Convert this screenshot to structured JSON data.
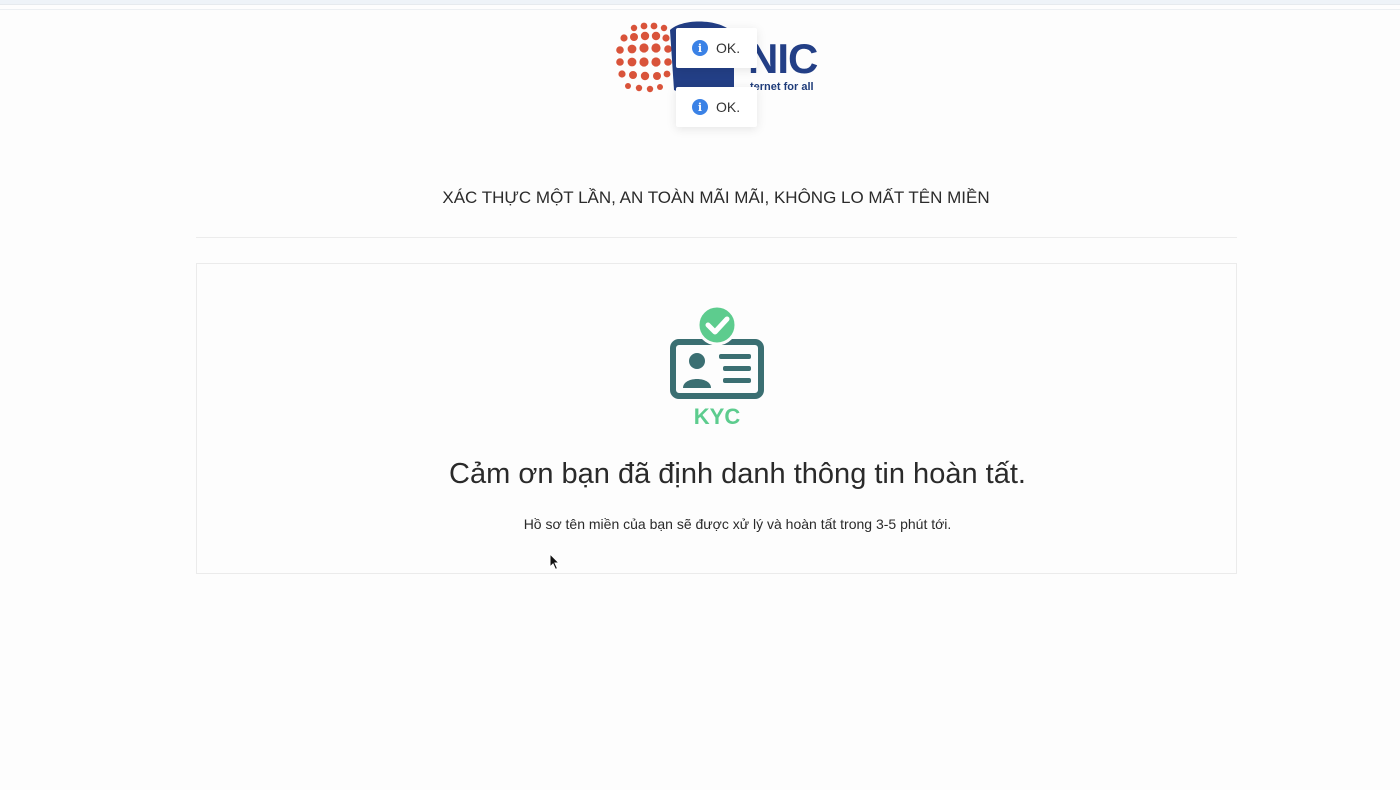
{
  "logo": {
    "brand_text": "NIC",
    "tagline": "ternet for all",
    "alt": "VNNIC logo"
  },
  "toasts": [
    {
      "icon": "info-icon",
      "message": "OK."
    },
    {
      "icon": "info-icon",
      "message": "OK."
    }
  ],
  "header": {
    "headline": "XÁC THỰC MỘT LẦN, AN TOÀN MÃI MÃI, KHÔNG LO MẤT TÊN MIỀN"
  },
  "card": {
    "illustration_label": "KYC",
    "title": "Cảm ơn bạn đã định danh thông tin hoàn tất.",
    "subtitle": "Hồ sơ tên miền của bạn sẽ được xử lý và hoàn tất trong 3-5 phút tới."
  },
  "colors": {
    "brand_blue": "#233f86",
    "logo_dots": "#d9533a",
    "kyc_dark": "#3b6f72",
    "kyc_green": "#5dcc8e",
    "info_blue": "#3b82e6"
  }
}
